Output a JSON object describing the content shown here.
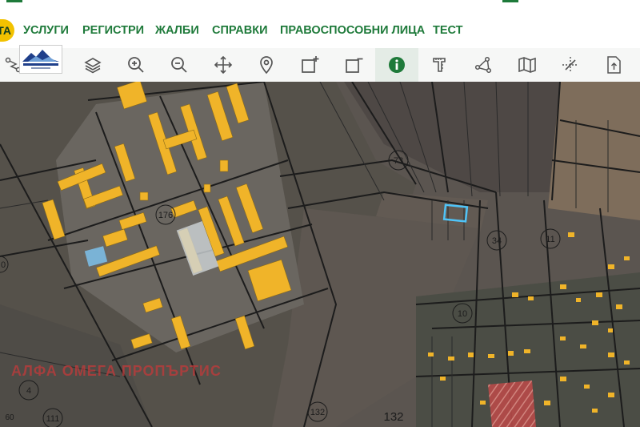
{
  "nav": {
    "badge": "ТА",
    "items": [
      "УСЛУГИ",
      "РЕГИСТРИ",
      "ЖАЛБИ",
      "СПРАВКИ",
      "ПРАВОСПОСОБНИ ЛИЦА",
      "ТЕСТ"
    ]
  },
  "logo": {
    "line1": "АЛФА ОМЕГА ПРОПЪРТИС",
    "line2": "REAL ESTATE"
  },
  "toolbar": {
    "tools": [
      "route-icon",
      "layers-icon",
      "zoom-in-icon",
      "zoom-out-icon",
      "pan-icon",
      "location-pin-icon",
      "add-rectangle-icon",
      "remove-rectangle-icon",
      "info-icon",
      "measure-icon",
      "polyline-icon",
      "map-icon",
      "intersection-icon",
      "export-icon"
    ],
    "active": "info-icon"
  },
  "map": {
    "watermark": "АЛФА ОМЕГА ПРОПЪРТИС",
    "parcel_labels": [
      "73",
      "176",
      "34",
      "11",
      "10",
      "132",
      "111",
      "132",
      "0",
      "4",
      "60"
    ]
  },
  "colors": {
    "brand": "#1e7a3a",
    "accent": "#f2c200",
    "building": "#f0b429",
    "selection": "#4fc3f7"
  }
}
